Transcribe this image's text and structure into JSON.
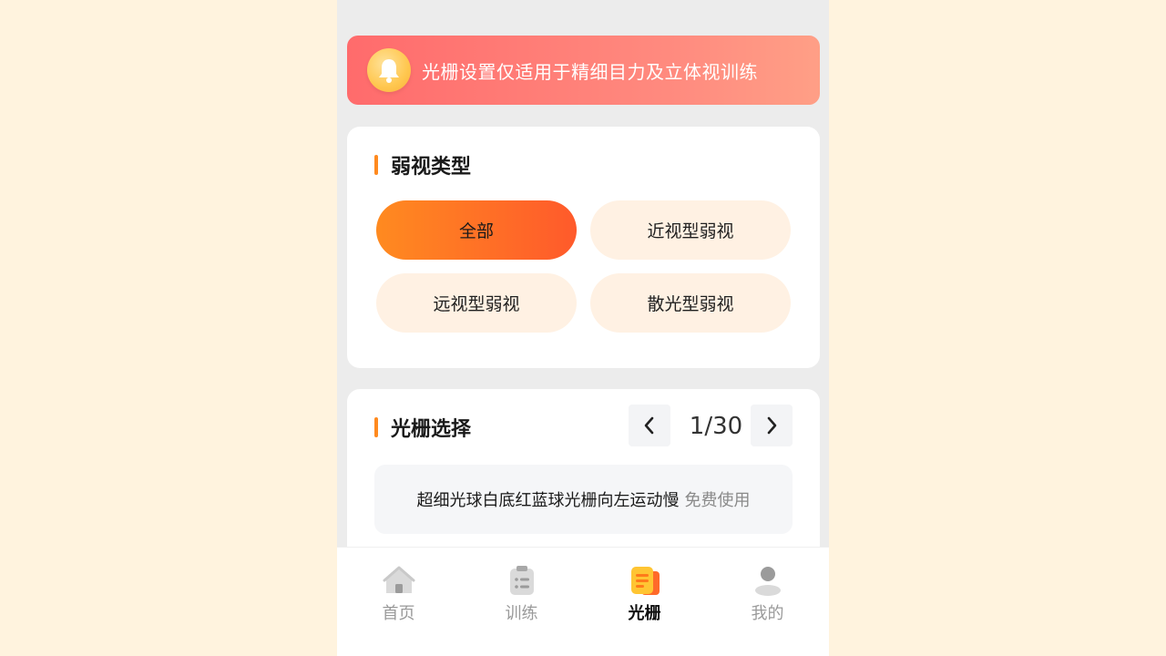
{
  "notice": {
    "icon": "bell-icon",
    "text": "光栅设置仅适用于精细目力及立体视训练"
  },
  "amblyopia": {
    "title": "弱视类型",
    "options": [
      {
        "label": "全部",
        "active": true
      },
      {
        "label": "近视型弱视",
        "active": false
      },
      {
        "label": "远视型弱视",
        "active": false
      },
      {
        "label": "散光型弱视",
        "active": false
      }
    ]
  },
  "grating": {
    "title": "光栅选择",
    "pager": {
      "current": "1",
      "total": "30",
      "text": "1/30"
    },
    "item": {
      "name": "超细光球白底红蓝球光栅向左运动慢",
      "tag": "免费使用"
    }
  },
  "tabbar": {
    "tabs": [
      {
        "label": "首页",
        "icon": "home-icon",
        "active": false
      },
      {
        "label": "训练",
        "icon": "clipboard-icon",
        "active": false
      },
      {
        "label": "光栅",
        "icon": "grating-icon",
        "active": true
      },
      {
        "label": "我的",
        "icon": "user-icon",
        "active": false
      }
    ]
  },
  "colors": {
    "accent": "#FF8A1F",
    "chip_active_start": "#FF8A20",
    "chip_active_end": "#FF5A2B",
    "chip_inactive": "#FFF1E3",
    "notice_start": "#FF6B6C",
    "notice_end": "#FF9F86",
    "page_bg": "#FFF3DE"
  }
}
